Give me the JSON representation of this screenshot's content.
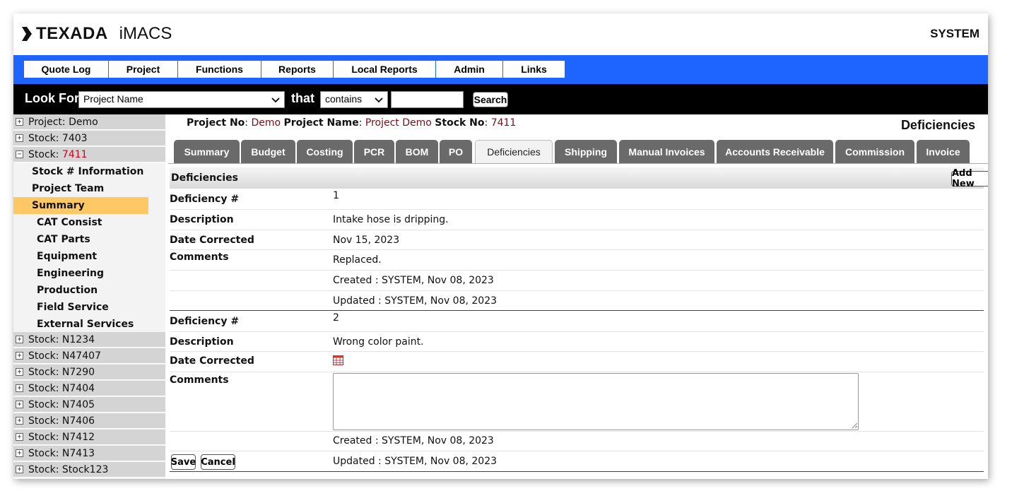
{
  "header": {
    "brand": "TEXADA",
    "app_name": "iMACS",
    "user": "SYSTEM",
    "accent_color": "#1e64ff"
  },
  "nav": {
    "items": [
      "Quote Log",
      "Project",
      "Functions",
      "Reports",
      "Local Reports",
      "Admin",
      "Links"
    ]
  },
  "search": {
    "look_for_label": "Look For",
    "field_value": "Project Name",
    "that_label": "that",
    "operator_value": "contains",
    "query_value": "",
    "button_label": "Search"
  },
  "sidebar": {
    "nodes_top": [
      {
        "label": "Project: Demo",
        "icon": "plus"
      },
      {
        "label": "Stock: 7403",
        "icon": "plus"
      },
      {
        "prefix": "Stock: ",
        "highlight": "7411",
        "icon": "minus"
      }
    ],
    "sub_items": [
      "Stock # Information",
      "Project Team",
      "Summary",
      "CAT Consist",
      "CAT Parts",
      "Equipment",
      "Engineering",
      "Production",
      "Field Service",
      "External Services"
    ],
    "active_sub": "Summary",
    "nodes_bottom": [
      "Stock: N1234",
      "Stock: N47407",
      "Stock: N7290",
      "Stock: N7404",
      "Stock: N7405",
      "Stock: N7406",
      "Stock: N7412",
      "Stock: N7413",
      "Stock: Stock123"
    ]
  },
  "project": {
    "no_label": "Project No",
    "no_value": "Demo",
    "name_label": "Project Name",
    "name_value": "Project Demo",
    "stock_label": "Stock No",
    "stock_value": "7411"
  },
  "page_title": "Deficiencies",
  "tabs": [
    "Summary",
    "Budget",
    "Costing",
    "PCR",
    "BOM",
    "PO",
    "Deficiencies",
    "Shipping",
    "Manual Invoices",
    "Accounts Receivable",
    "Commission",
    "Invoice"
  ],
  "active_tab": "Deficiencies",
  "panel": {
    "title": "Deficiencies",
    "add_new_label": "Add New"
  },
  "labels": {
    "deficiency_no": "Deficiency #",
    "description": "Description",
    "date_corrected": "Date Corrected",
    "comments": "Comments"
  },
  "deficiency1": {
    "number": "1",
    "description": "Intake hose is dripping.",
    "date_corrected": "Nov 15, 2023",
    "comments": "Replaced.",
    "created": "Created : SYSTEM, Nov 08, 2023",
    "updated": "Updated : SYSTEM, Nov 08, 2023"
  },
  "deficiency2": {
    "number": "2",
    "description": "Wrong color paint.",
    "comments_value": "",
    "created": "Created : SYSTEM, Nov 08, 2023",
    "updated": "Updated : SYSTEM, Nov 08, 2023",
    "save_label": "Save",
    "cancel_label": "Cancel"
  }
}
